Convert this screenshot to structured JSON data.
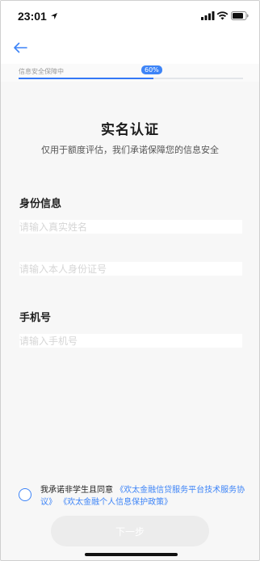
{
  "status_bar": {
    "time": "23:01"
  },
  "progress": {
    "label": "信息安全保障中",
    "badge": "60%",
    "value": 0.6
  },
  "page": {
    "title": "实名认证",
    "subtitle": "仅用于额度评估，我们承诺保障您的信息安全"
  },
  "form": {
    "identity_section": "身份信息",
    "name_placeholder": "请输入真实姓名",
    "id_placeholder": "请输入本人身份证号",
    "phone_section": "手机号",
    "phone_placeholder": "请输入手机号"
  },
  "agreement": {
    "prefix": "我承诺非学生且同意",
    "link1": "《欢太金融信贷服务平台技术服务协议》",
    "link2": "《欢太金融个人信息保护政策》"
  },
  "buttons": {
    "next": "下一步"
  },
  "colors": {
    "accent": "#3d84f7",
    "button_disabled": "#ececec"
  },
  "icons": {
    "back": "arrow-left-icon",
    "location": "location-arrow-icon",
    "signal": "cellular-signal-icon",
    "wifi": "wifi-icon",
    "battery": "battery-icon",
    "radio": "radio-unchecked-icon"
  }
}
